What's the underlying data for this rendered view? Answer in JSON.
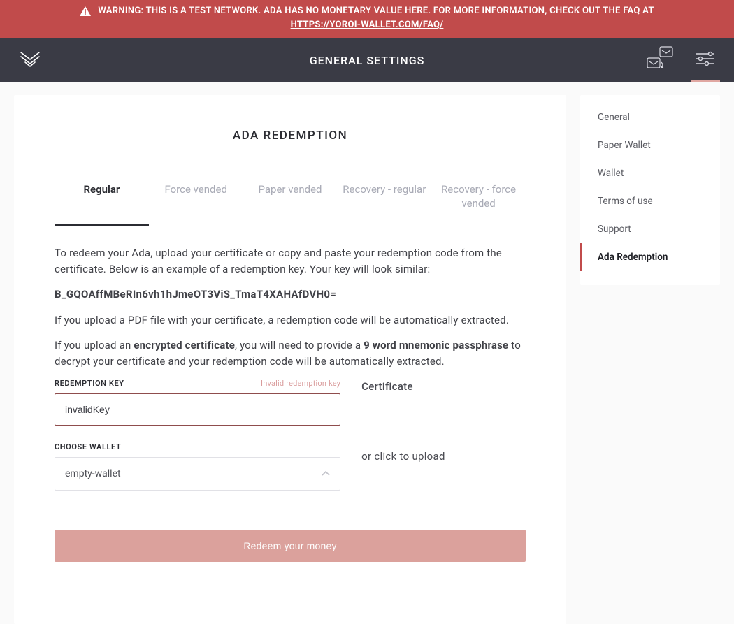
{
  "banner": {
    "warning_text": "WARNING: THIS IS A TEST NETWORK. ADA HAS NO MONETARY VALUE HERE. FOR MORE INFORMATION, CHECK OUT THE FAQ AT",
    "faq_url_label": "HTTPS://YOROI-WALLET.COM/FAQ/"
  },
  "header": {
    "title": "GENERAL SETTINGS"
  },
  "main": {
    "section_title": "ADA REDEMPTION",
    "tabs": [
      "Regular",
      "Force vended",
      "Paper vended",
      "Recovery - regular",
      "Recovery - force vended"
    ],
    "active_tab_index": 0,
    "instructions": {
      "p1": "To redeem your Ada, upload your certificate or copy and paste your redemption code from the certificate. Below is an example of a redemption key. Your key will look similar:",
      "example_key": "B_GQOAffMBeRIn6vh1hJmeOT3ViS_TmaT4XAHAfDVH0=",
      "p2": "If you upload a PDF file with your certificate, a redemption code will be automatically extracted.",
      "p3_a": "If you upload an ",
      "p3_bold1": "encrypted certificate",
      "p3_b": ", you will need to provide a ",
      "p3_bold2": "9 word mnemonic passphrase",
      "p3_c": " to decrypt your certificate and your redemption code will be automatically extracted."
    },
    "form": {
      "redemption_key_label": "REDEMPTION KEY",
      "redemption_key_error": "Invalid redemption key",
      "redemption_key_value": "invalidKey",
      "choose_wallet_label": "CHOOSE WALLET",
      "choose_wallet_value": "empty-wallet",
      "certificate_label": "Certificate",
      "upload_hint": "or click to upload",
      "redeem_button_label": "Redeem your money"
    }
  },
  "sidebar": {
    "items": [
      "General",
      "Paper Wallet",
      "Wallet",
      "Terms of use",
      "Support",
      "Ada Redemption"
    ],
    "active_index": 5
  },
  "colors": {
    "accent_red": "#c14b4b",
    "header_bg": "#3a3b45",
    "button_pink": "#dba19c"
  }
}
